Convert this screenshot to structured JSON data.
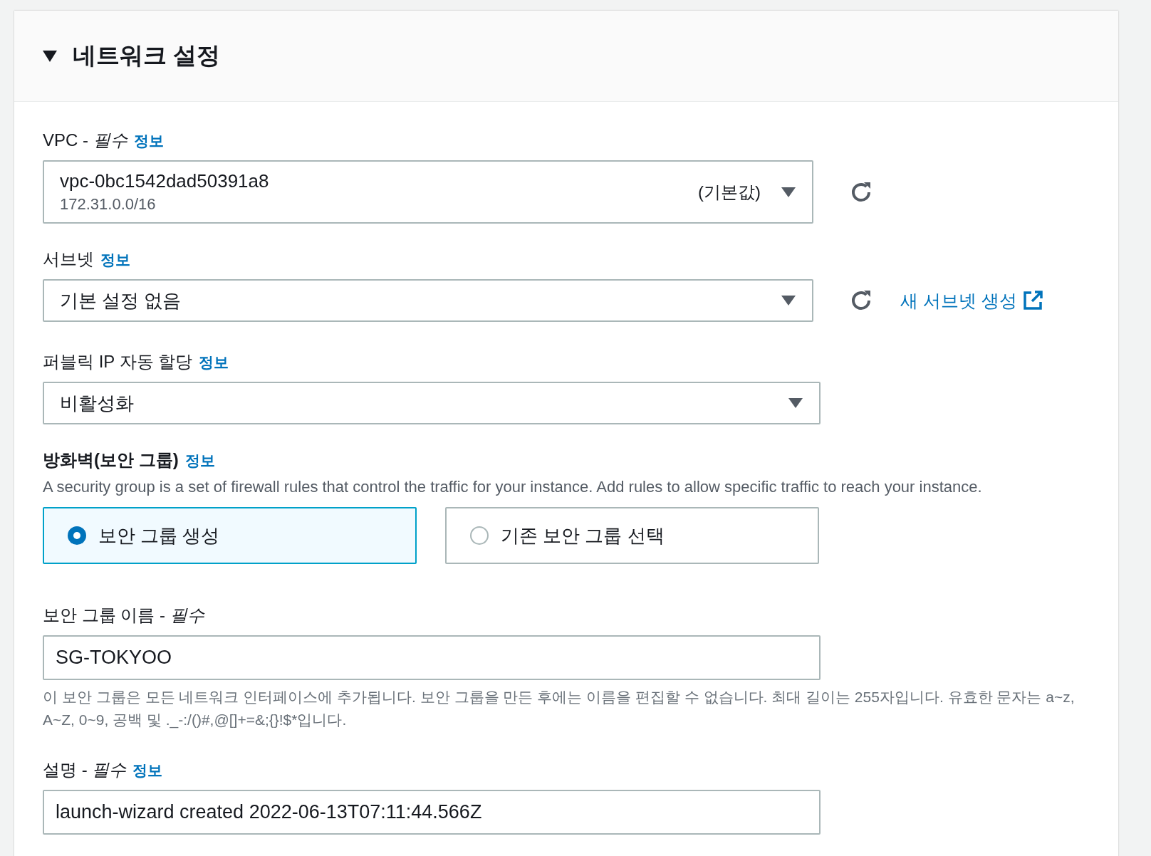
{
  "section": {
    "title": "네트워크 설정",
    "expanded": true
  },
  "fields": [
    {
      "kind": "select",
      "label": "VPC - *필수*",
      "info": "정보",
      "value": "vpc-0bc1542dad50391a8",
      "tag": "(기본값)",
      "sub": "172.31.0.0/16",
      "refresh": true
    },
    {
      "kind": "select",
      "label": "서브넷",
      "info": "정보",
      "value": "기본 설정 없음",
      "refresh": true,
      "link": "새 서브넷 생성"
    },
    {
      "kind": "select",
      "label": "퍼블릭 IP 자동 할당",
      "info": "정보",
      "value": "비활성화"
    },
    {
      "kind": "radio",
      "label": "방화벽(보안 그룹)",
      "info": "정보",
      "description": "A security group is a set of firewall rules that control the traffic for your instance. Add rules to allow specific traffic to reach your instance.",
      "options": [
        {
          "label": "보안 그룹 생성",
          "selected": true
        },
        {
          "label": "기존 보안 그룹 선택",
          "selected": false
        }
      ]
    },
    {
      "kind": "text",
      "label": "보안 그룹 이름 - *필수*",
      "value": "SG-TOKYOO",
      "hint": "이 보안 그룹은 모든 네트워크 인터페이스에 추가됩니다. 보안 그룹을 만든 후에는 이름을 편집할 수 없습니다. 최대 길이는 255자입니다. 유효한 문자는 a~z, A~Z, 0~9, 공백 및 ._-:/()#,@[]+=&;{}!$*입니다."
    },
    {
      "kind": "text",
      "label": "설명 - *필수*",
      "info": "정보",
      "value": "launch-wizard created 2022-06-13T07:11:44.566Z"
    }
  ]
}
